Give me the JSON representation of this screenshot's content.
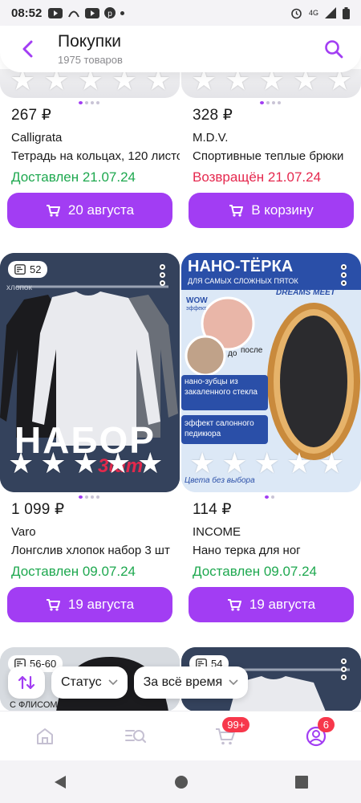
{
  "status_bar": {
    "time": "08:52",
    "network": "4G"
  },
  "header": {
    "title": "Покупки",
    "subtitle": "1975 товаров"
  },
  "cards": [
    {
      "price": "267 ₽",
      "brand": "Calligrata",
      "name": "Тетрадь на кольцах, 120 листов",
      "status": "Доставлен 21.07.24",
      "status_kind": "delivered",
      "button": "20 августа"
    },
    {
      "price": "328 ₽",
      "brand": "M.D.V.",
      "name": "Спортивные теплые брюки",
      "status": "Возвращён 21.07.24",
      "status_kind": "returned",
      "button": "В корзину"
    },
    {
      "price": "1 099 ₽",
      "brand": "Varo",
      "name": "Лонгслив хлопок набор 3 шт",
      "status": "Доставлен 09.07.24",
      "status_kind": "delivered",
      "button": "19 августа",
      "badge": "52",
      "image_text": "НАБОР",
      "image_text2": "3шт",
      "image_label": "хлопок"
    },
    {
      "price": "114 ₽",
      "brand": "INCOME",
      "name": "Нано терка для ног",
      "status": "Доставлен 09.07.24",
      "status_kind": "delivered",
      "button": "19 августа",
      "image_title": "НАНО-ТЁРКА",
      "image_sub": "ДЛЯ САМЫХ СЛОЖНЫХ ПЯТОК",
      "image_brand": "DREAMS MEET",
      "image_wow": "WOW",
      "image_wow2": "эффект",
      "image_do": "до",
      "image_posle": "после",
      "image_teeth": "нано-зубцы из закаленного стекла",
      "image_effect": "эффект салонного педикюра",
      "image_colors": "Цвета без выбора"
    },
    {
      "badge": "56-60",
      "image_text": "С ФЛИСОМ"
    },
    {
      "badge": "54"
    }
  ],
  "filters": {
    "status": "Статус",
    "period": "За всё время"
  },
  "bottom_nav": {
    "cart_badge": "99+",
    "profile_badge": "6"
  },
  "colors": {
    "accent": "#a23df3",
    "delivered": "#1ea84f",
    "returned": "#e5284e",
    "badge": "#f7374b"
  }
}
